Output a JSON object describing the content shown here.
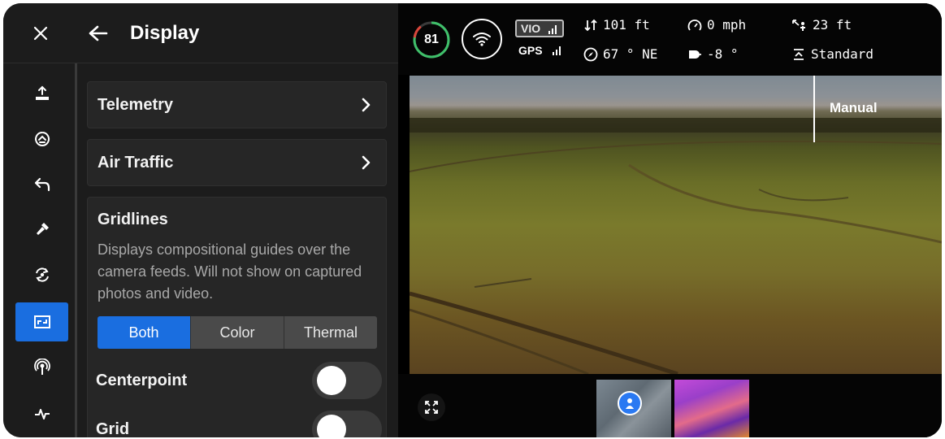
{
  "rail": {
    "items": [
      {
        "name": "takeoff-icon",
        "active": false
      },
      {
        "name": "flight-mode-icon",
        "active": false
      },
      {
        "name": "return-home-icon",
        "active": false
      },
      {
        "name": "flashlight-icon",
        "active": false
      },
      {
        "name": "rotate-camera-icon",
        "active": false
      },
      {
        "name": "display-icon",
        "active": true
      },
      {
        "name": "antenna-icon",
        "active": false
      },
      {
        "name": "telemetry-icon",
        "active": false
      }
    ]
  },
  "panel": {
    "title": "Display",
    "telemetry_label": "Telemetry",
    "air_traffic_label": "Air Traffic",
    "gridlines": {
      "title": "Gridlines",
      "description": "Displays compositional guides over the camera feeds. Will not show on captured photos and video.",
      "options": [
        "Both",
        "Color",
        "Thermal"
      ],
      "selected": "Both"
    },
    "centerpoint_label": "Centerpoint",
    "centerpoint_on": false,
    "grid_label": "Grid",
    "grid_on": false
  },
  "status": {
    "battery_percent": "81",
    "battery_level": 0.81,
    "vio_label": "VIO",
    "gps_label": "GPS",
    "altitude": "101 ft",
    "heading": "67 ° NE",
    "speed": "0 mph",
    "gimbal_pitch": "-8 °",
    "distance": "23 ft",
    "flight_mode": "Standard"
  },
  "camera": {
    "mode_label": "Manual"
  },
  "colors": {
    "accent": "#1a6ee0",
    "battery_green": "#3fbf6a",
    "battery_red": "#d9453a"
  }
}
